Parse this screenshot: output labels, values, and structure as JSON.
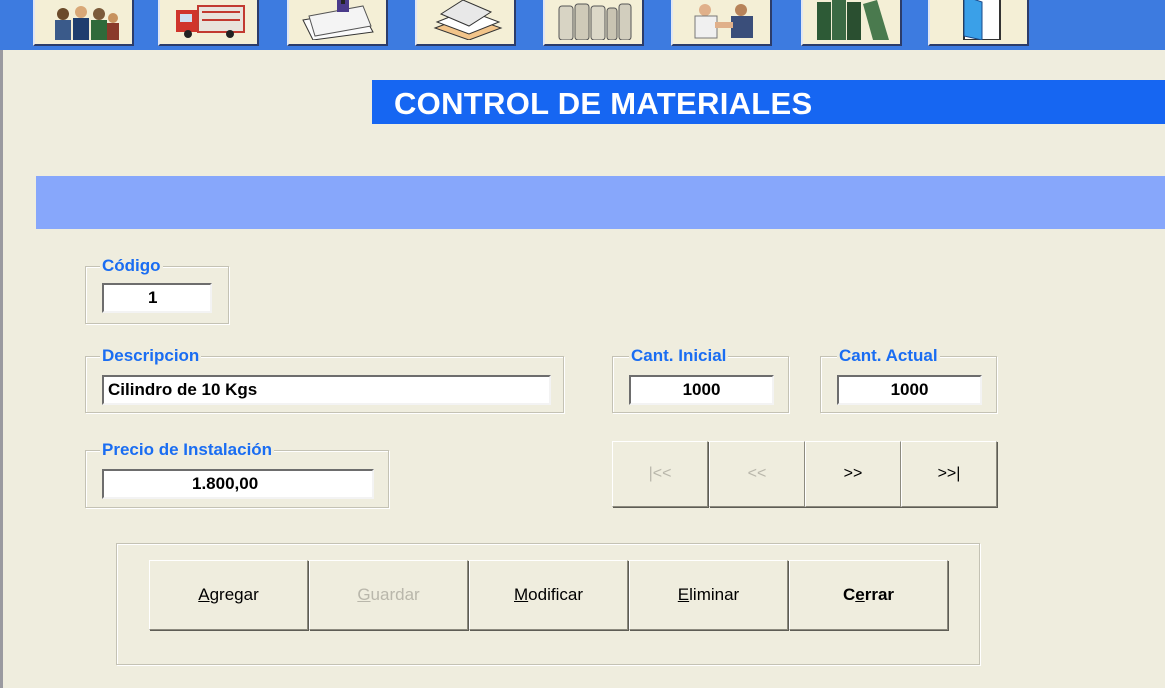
{
  "toolbar": {
    "buttons": [
      {
        "icon": "people-group-icon"
      },
      {
        "icon": "truck-icon"
      },
      {
        "icon": "clipped-papers-icon"
      },
      {
        "icon": "paper-stack-icon"
      },
      {
        "icon": "gas-cylinders-icon"
      },
      {
        "icon": "handshake-icon"
      },
      {
        "icon": "binders-icon"
      },
      {
        "icon": "exit-door-icon"
      }
    ],
    "color": "#3d7be0"
  },
  "header": {
    "title": "CONTROL DE MATERIALES",
    "title_bg": "#1666f2",
    "band_color": "#87a7fb"
  },
  "form": {
    "codigo": {
      "label": "Código",
      "value": "1"
    },
    "descripcion": {
      "label": "Descripcion",
      "value": "Cilindro de 10 Kgs"
    },
    "cant_inicial": {
      "label": "Cant. Inicial",
      "value": "1000"
    },
    "cant_actual": {
      "label": "Cant. Actual",
      "value": "1000"
    },
    "precio": {
      "label": "Precio de Instalación",
      "value": "1.800,00"
    },
    "label_color": "#1a6df2"
  },
  "navigation": {
    "first": "|<<",
    "prev": "<<",
    "next": ">>",
    "last": ">>|"
  },
  "actions": {
    "agregar": {
      "pre": "",
      "key": "A",
      "post": "gregar"
    },
    "guardar": {
      "pre": "",
      "key": "G",
      "post": "uardar"
    },
    "modificar": {
      "pre": "",
      "key": "M",
      "post": "odificar"
    },
    "eliminar": {
      "pre": "",
      "key": "E",
      "post": "liminar"
    },
    "cerrar": {
      "pre": "C",
      "key": "e",
      "post": "rrar"
    }
  }
}
